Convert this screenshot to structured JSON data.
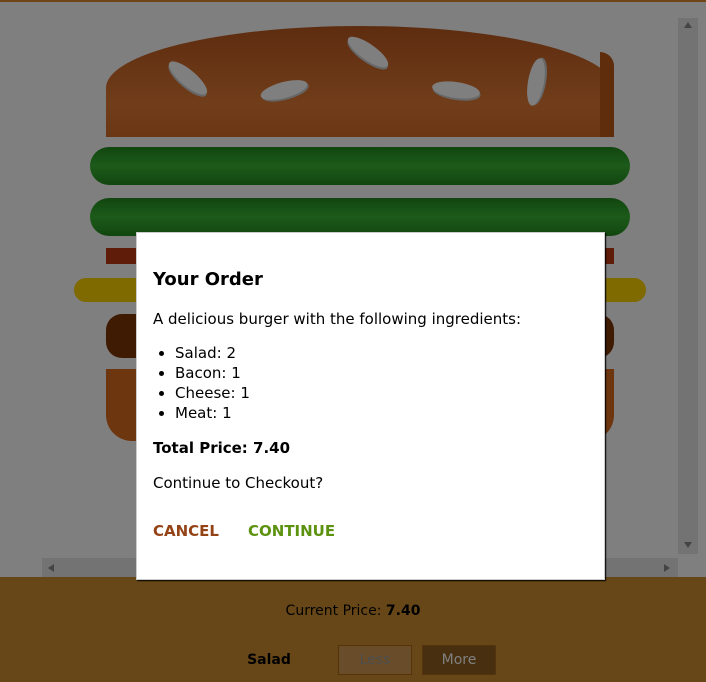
{
  "modal": {
    "title": "Your Order",
    "intro": "A delicious burger with the following ingredients:",
    "ingredients": [
      {
        "name": "Salad",
        "qty": "2"
      },
      {
        "name": "Bacon",
        "qty": "1"
      },
      {
        "name": "Cheese",
        "qty": "1"
      },
      {
        "name": "Meat",
        "qty": "1"
      }
    ],
    "total_label": "Total Price:",
    "total_value": "7.40",
    "question": "Continue to Checkout?",
    "cancel_label": "CANCEL",
    "continue_label": "CONTINUE"
  },
  "controls": {
    "current_price_label": "Current Price:",
    "current_price_value": "7.40",
    "rows": [
      {
        "label": "Salad",
        "less_label": "Less",
        "more_label": "More",
        "less_disabled": true
      }
    ]
  },
  "colors": {
    "cancel": "#944317",
    "continue": "#5c9210",
    "controls_bg": "#cf8f2e"
  }
}
